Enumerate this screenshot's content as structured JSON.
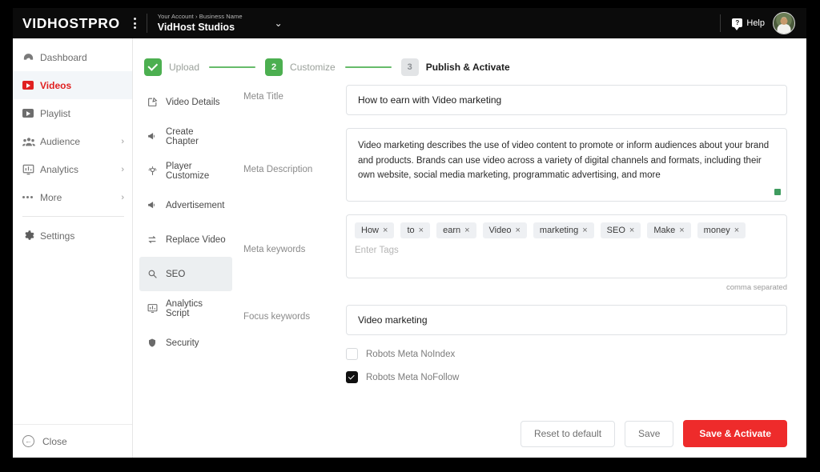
{
  "topbar": {
    "brand": "VIDHOSTPRO",
    "menu_icon": "kebab-menu-icon",
    "account_breadcrumb": "Your Account › Business Name",
    "account_name": "VidHost Studios",
    "account_caret": "⌄",
    "help_label": "Help",
    "help_glyph": "?"
  },
  "sidebar": {
    "items": [
      {
        "label": "Dashboard",
        "icon": "gauge-icon",
        "chevron": "",
        "active": false
      },
      {
        "label": "Videos",
        "icon": "video-play-icon",
        "chevron": "",
        "active": true
      },
      {
        "label": "Playlist",
        "icon": "playlist-play-icon",
        "chevron": "",
        "active": false
      },
      {
        "label": "Audience",
        "icon": "people-icon",
        "chevron": "›",
        "active": false
      },
      {
        "label": "Analytics",
        "icon": "analytics-monitor-icon",
        "chevron": "›",
        "active": false
      },
      {
        "label": "More",
        "icon": "ellipsis-icon",
        "chevron": "›",
        "active": false
      },
      {
        "label": "Settings",
        "icon": "gear-icon",
        "chevron": "",
        "active": false
      }
    ],
    "close_label": "Close",
    "close_glyph": "←"
  },
  "stepper": {
    "steps": [
      {
        "num": "1",
        "label": "Upload",
        "state": "done"
      },
      {
        "num": "2",
        "label": "Customize",
        "state": "current"
      },
      {
        "num": "3",
        "label": "Publish & Activate",
        "state": "todo"
      }
    ]
  },
  "submenu": {
    "items": [
      {
        "label": "Video Details",
        "icon": "edit-square-icon",
        "active": false
      },
      {
        "label": "Create Chapter",
        "icon": "megaphone-icon",
        "active": false
      },
      {
        "label": "Player Customize",
        "icon": "player-settings-icon",
        "active": false
      },
      {
        "label": "Advertisement",
        "icon": "megaphone-icon",
        "active": false
      },
      {
        "label": "Replace Video",
        "icon": "swap-arrows-icon",
        "active": false
      },
      {
        "label": "SEO",
        "icon": "search-icon",
        "active": true
      },
      {
        "label": "Analytics Script",
        "icon": "analytics-monitor-icon",
        "active": false
      },
      {
        "label": "Security",
        "icon": "shield-icon",
        "active": false
      }
    ]
  },
  "form": {
    "meta_title": {
      "label": "Meta Title",
      "value": "How to earn with Video marketing"
    },
    "meta_description": {
      "label": "Meta Description",
      "value": "Video marketing describes the use of video content to promote or inform audiences about your brand and products. Brands can use video across a variety of digital channels and formats, including their own website, social media marketing, programmatic advertising, and more"
    },
    "meta_keywords": {
      "label": "Meta keywords",
      "tags": [
        "How",
        "to",
        "earn",
        "Video",
        "marketing",
        "SEO",
        "Make",
        "money"
      ],
      "remove_glyph": "×",
      "placeholder": "Enter Tags",
      "hint": "comma separated"
    },
    "focus_keywords": {
      "label": "Focus keywords",
      "value": "Video marketing"
    },
    "checkboxes": [
      {
        "label": "Robots Meta NoIndex",
        "checked": false
      },
      {
        "label": "Robots Meta NoFollow",
        "checked": true
      }
    ]
  },
  "actions": {
    "reset": "Reset to default",
    "save": "Save",
    "save_activate": "Save & Activate"
  },
  "colors": {
    "brand_red": "#e02020",
    "primary_button": "#ee2b2b",
    "step_green": "#4caf50",
    "line_green": "#66bb6a",
    "topbar_bg": "#0b0b0b"
  }
}
